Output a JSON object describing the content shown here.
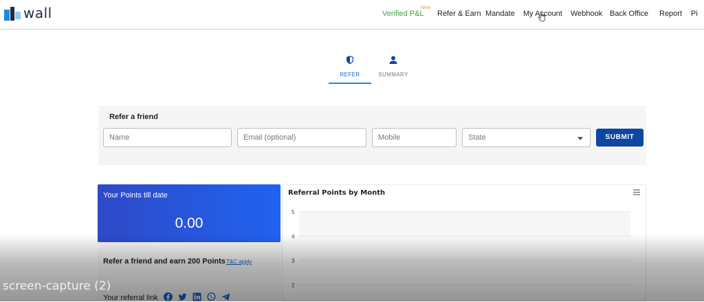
{
  "brand": {
    "name": "wall"
  },
  "nav": {
    "items": [
      {
        "label": "Verified P&L",
        "badge": "New"
      },
      {
        "label": "Refer & Earn"
      },
      {
        "label": "Mandate"
      },
      {
        "label": "My Account"
      },
      {
        "label": "Webhook"
      },
      {
        "label": "Back Office"
      },
      {
        "label": "Report"
      },
      {
        "label": "Pi"
      }
    ]
  },
  "tabs": [
    {
      "label": "REFER",
      "icon": "shield-icon",
      "active": true
    },
    {
      "label": "SUMMARY",
      "icon": "person-icon",
      "active": false
    }
  ],
  "refer_form": {
    "title": "Refer a friend",
    "name_placeholder": "Name",
    "email_placeholder": "Email (optional)",
    "mobile_placeholder": "Mobile",
    "state_value": "State",
    "submit_label": "SUBMIT"
  },
  "points": {
    "title": "Your Points till date",
    "value": "0.00"
  },
  "earn": {
    "text": "Refer a friend and earn 200 Points",
    "tc_label": "T&C apply",
    "referral_link_label": "Your referral link",
    "share_icons": [
      "facebook-icon",
      "twitter-icon",
      "linkedin-icon",
      "whatsapp-icon",
      "telegram-icon"
    ]
  },
  "chart_data": {
    "type": "bar",
    "title": "Referral Points by Month",
    "categories": [],
    "values": [],
    "y_ticks": [
      "5",
      "4",
      "3",
      "2"
    ],
    "grid": true
  },
  "watermark": "screen-capture (2)",
  "colors": {
    "accent": "#1e88e5",
    "submit": "#0d47a1",
    "pl_green": "#43a047",
    "badge": "#f0a020",
    "card_start": "#2f49c8",
    "card_end": "#2063f0"
  }
}
